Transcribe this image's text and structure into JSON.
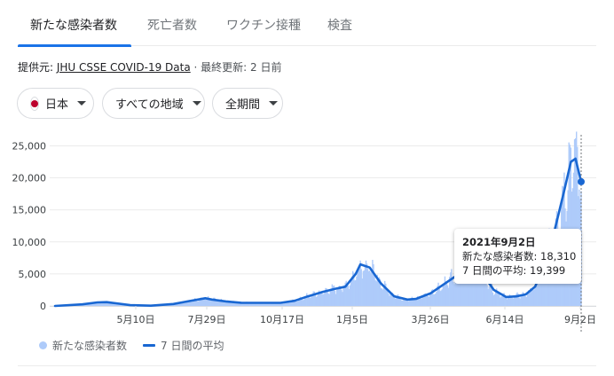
{
  "tabs": [
    {
      "label": "新たな感染者数",
      "active": true
    },
    {
      "label": "死亡者数",
      "active": false
    },
    {
      "label": "ワクチン接種",
      "active": false
    },
    {
      "label": "検査",
      "active": false
    }
  ],
  "source": {
    "prefix": "提供元: ",
    "link": "JHU CSSE COVID-19 Data",
    "updated": " · 最終更新: 2 日前"
  },
  "filters": {
    "country": "日本",
    "region": "すべての地域",
    "period": "全期間"
  },
  "tooltip": {
    "date": "2021年9月2日",
    "cases_label": "新たな感染者数: 18,310",
    "avg_label": "7 日間の平均: 19,399"
  },
  "legend": {
    "cases": "新たな感染者数",
    "avg": "7 日間の平均"
  },
  "colors": {
    "accent": "#1a73e8",
    "bars": "#aecbfa",
    "line": "#1967d2"
  },
  "chart_data": {
    "type": "area",
    "title": "",
    "xlabel": "",
    "ylabel": "",
    "ylim": [
      0,
      27000
    ],
    "y_ticks": [
      0,
      5000,
      10000,
      15000,
      20000,
      25000
    ],
    "y_tick_labels": [
      "0",
      "5,000",
      "10,000",
      "15,000",
      "20,000",
      "25,000"
    ],
    "x_ticks": [
      "5月10日",
      "7月29日",
      "10月17日",
      "1月5日",
      "3月26日",
      "6月14日",
      "9月2日"
    ],
    "x_range": [
      "2020-02-20",
      "2021-09-02"
    ],
    "grid": true,
    "series": [
      {
        "name": "7 日間の平均",
        "dates": [
          "2020-02-20",
          "2020-03-20",
          "2020-04-05",
          "2020-04-15",
          "2020-04-25",
          "2020-05-10",
          "2020-06-01",
          "2020-06-25",
          "2020-07-10",
          "2020-07-29",
          "2020-08-05",
          "2020-08-20",
          "2020-09-05",
          "2020-09-25",
          "2020-10-17",
          "2020-11-01",
          "2020-11-15",
          "2020-12-01",
          "2020-12-15",
          "2020-12-25",
          "2021-01-05",
          "2021-01-10",
          "2021-01-20",
          "2021-02-01",
          "2021-02-15",
          "2021-03-01",
          "2021-03-10",
          "2021-03-26",
          "2021-04-10",
          "2021-04-25",
          "2021-05-05",
          "2021-05-12",
          "2021-05-20",
          "2021-06-01",
          "2021-06-14",
          "2021-06-25",
          "2021-07-05",
          "2021-07-15",
          "2021-07-25",
          "2021-08-05",
          "2021-08-15",
          "2021-08-22",
          "2021-08-27",
          "2021-09-02"
        ],
        "values": [
          0,
          250,
          550,
          600,
          420,
          120,
          40,
          300,
          700,
          1200,
          1000,
          700,
          500,
          480,
          480,
          800,
          1500,
          2200,
          2700,
          3000,
          5000,
          6500,
          6000,
          3500,
          1500,
          1000,
          1100,
          2000,
          3500,
          5000,
          5800,
          5700,
          5000,
          2500,
          1400,
          1500,
          1800,
          3000,
          6500,
          12000,
          18000,
          22500,
          23000,
          19399
        ]
      }
    ],
    "bar_note": "daily new cases, shown as light bars around the average"
  }
}
